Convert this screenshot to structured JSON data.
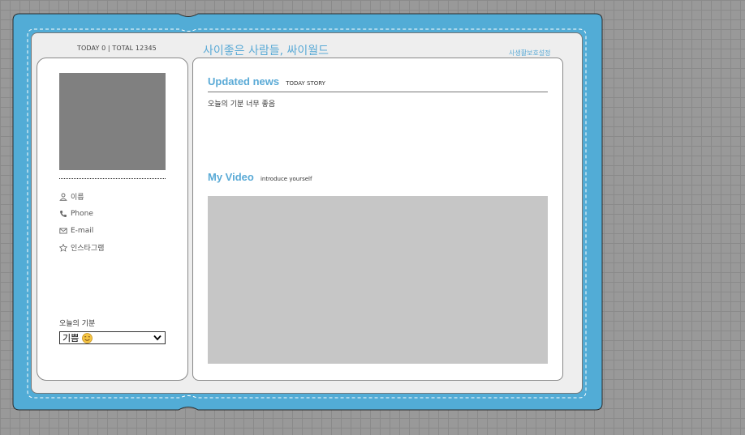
{
  "colors": {
    "frame": "#52acd6",
    "accent": "#5aaad6",
    "photo_placeholder": "#808080",
    "video_placeholder": "#c6c6c6"
  },
  "header": {
    "counter": "TODAY 0 | TOTAL 12345",
    "site_title": "사이좋은 사람들, 싸이월드",
    "privacy_link": "사생활보호설정"
  },
  "profile": {
    "info": [
      {
        "icon": "user-icon",
        "label": "이름"
      },
      {
        "icon": "phone-icon",
        "label": "Phone"
      },
      {
        "icon": "mail-icon",
        "label": "E-mail"
      },
      {
        "icon": "star-icon",
        "label": "인스타그램"
      }
    ],
    "mood_label": "오늘의 기분",
    "mood_selected": "기쁨",
    "mood_icon": "smiling-face-icon"
  },
  "news": {
    "title": "Updated news",
    "subtitle": "TODAY STORY",
    "text": "오늘의 기분 너무 좋음"
  },
  "video": {
    "title": "My Video",
    "subtitle": "introduce yourself"
  }
}
